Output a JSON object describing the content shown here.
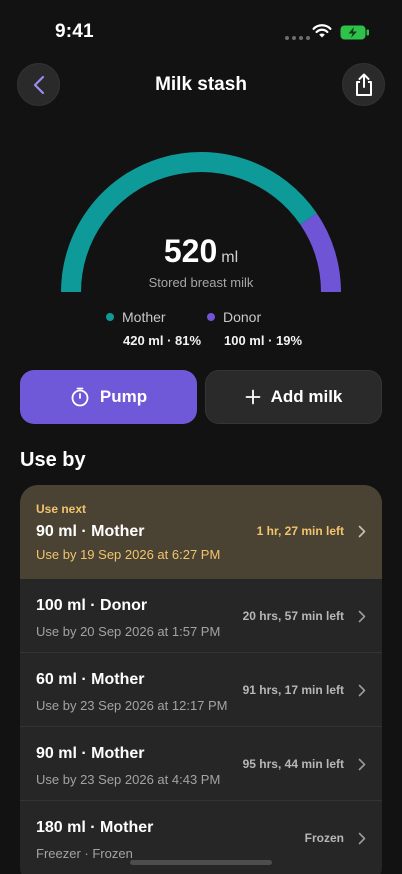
{
  "status": {
    "time": "9:41"
  },
  "header": {
    "title": "Milk stash"
  },
  "summary": {
    "amount": "520",
    "unit": "ml",
    "label": "Stored breast milk",
    "mother_fraction": 0.81,
    "donor_fraction": 0.19
  },
  "legend": [
    {
      "name": "Mother",
      "value": "420 ml · 81%",
      "color": "#0f9a9a"
    },
    {
      "name": "Donor",
      "value": "100 ml · 19%",
      "color": "#7054d6"
    }
  ],
  "actions": {
    "pump": "Pump",
    "add": "Add milk"
  },
  "section": {
    "title": "Use by"
  },
  "items": [
    {
      "tag": "Use next",
      "title": "90 ml · Mother",
      "sub": "Use by 19 Sep 2026 at 6:27 PM",
      "right": "1 hr, 27 min left"
    },
    {
      "title": "100 ml · Donor",
      "sub": "Use by 20 Sep 2026 at 1:57 PM",
      "right": "20 hrs, 57 min left"
    },
    {
      "title": "60 ml · Mother",
      "sub": "Use by 23 Sep 2026 at 12:17 PM",
      "right": "91 hrs, 17 min left"
    },
    {
      "title": "90 ml · Mother",
      "sub": "Use by 23 Sep 2026 at 4:43 PM",
      "right": "95 hrs, 44 min left"
    },
    {
      "title": "180 ml · Mother",
      "sub": "Freezer · Frozen",
      "right": "Frozen"
    }
  ],
  "colors": {
    "accent": "#6f59d8",
    "mother": "#0f9a9a",
    "donor": "#7054d6",
    "warning": "#f2c46d"
  }
}
